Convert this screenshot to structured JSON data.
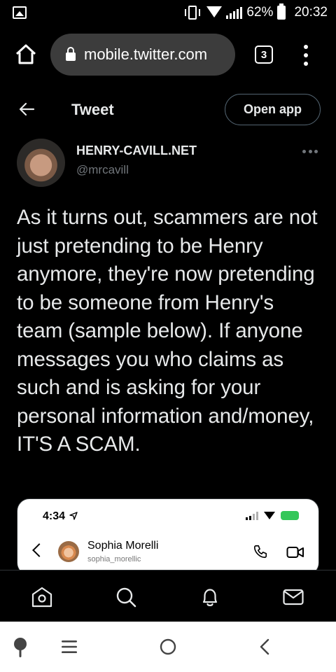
{
  "status_bar": {
    "battery": "62%",
    "time": "20:32"
  },
  "browser": {
    "url": "mobile.twitter.com",
    "tab_count": "3"
  },
  "header": {
    "title": "Tweet",
    "open_app_label": "Open app"
  },
  "tweet": {
    "display_name": "HENRY-CAVILL.NET",
    "handle": "@mrcavill",
    "text": "As it turns out, scammers are not just pretending to be Henry anymore, they're now pretending to be someone from Henry's team (sample below). If anyone messages you who claims as such and is asking for your personal information and/money, IT'S A SCAM."
  },
  "media": {
    "time": "4:34",
    "contact_name": "Sophia Morelli",
    "contact_handle": "sophia_morellic"
  },
  "bottom_nav": {
    "items": [
      "home-icon",
      "search-icon",
      "notifications-icon",
      "messages-icon"
    ]
  },
  "colors": {
    "background": "#000000",
    "text": "#e7e9ea",
    "muted": "#71767b",
    "border": "#2f3336",
    "url_pill": "#3c3c3c"
  }
}
